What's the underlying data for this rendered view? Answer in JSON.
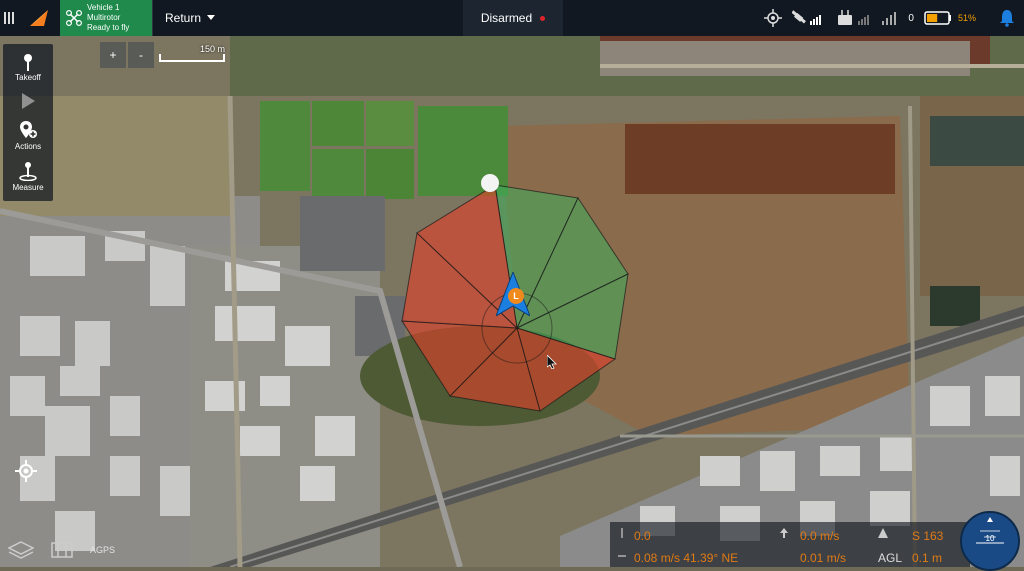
{
  "topbar": {
    "vehicle_name": "Vehicle 1",
    "vehicle_type": "Multirotor",
    "vehicle_status": "Ready to fly",
    "flight_mode": "Return",
    "arm_status": "Disarmed",
    "rc_count": "0",
    "battery_percent": "51%"
  },
  "toolbar": {
    "takeoff": "Takeoff",
    "actions": "Actions",
    "measure": "Measure"
  },
  "map": {
    "zoom_in": "+",
    "zoom_out": "-",
    "scale_label": "150 m",
    "home_marker": "L"
  },
  "telemetry": {
    "altitude_val": "0.0",
    "vertical_speed": "0.0 m/s",
    "heading": "S 163",
    "ground_speed": "0.08 m/s 41.39° NE",
    "horizontal_speed": "0.01 m/s",
    "agl_label": "AGL",
    "agl_value": "0.1 m"
  },
  "attitude": {
    "label": "10"
  },
  "bottom_left": {
    "label": "AGPS"
  },
  "colors": {
    "vehicle_green": "#1f8a4c",
    "battery": "#f4a000",
    "alert_blue": "#1c7fe0",
    "arm_red": "#e0242c"
  }
}
